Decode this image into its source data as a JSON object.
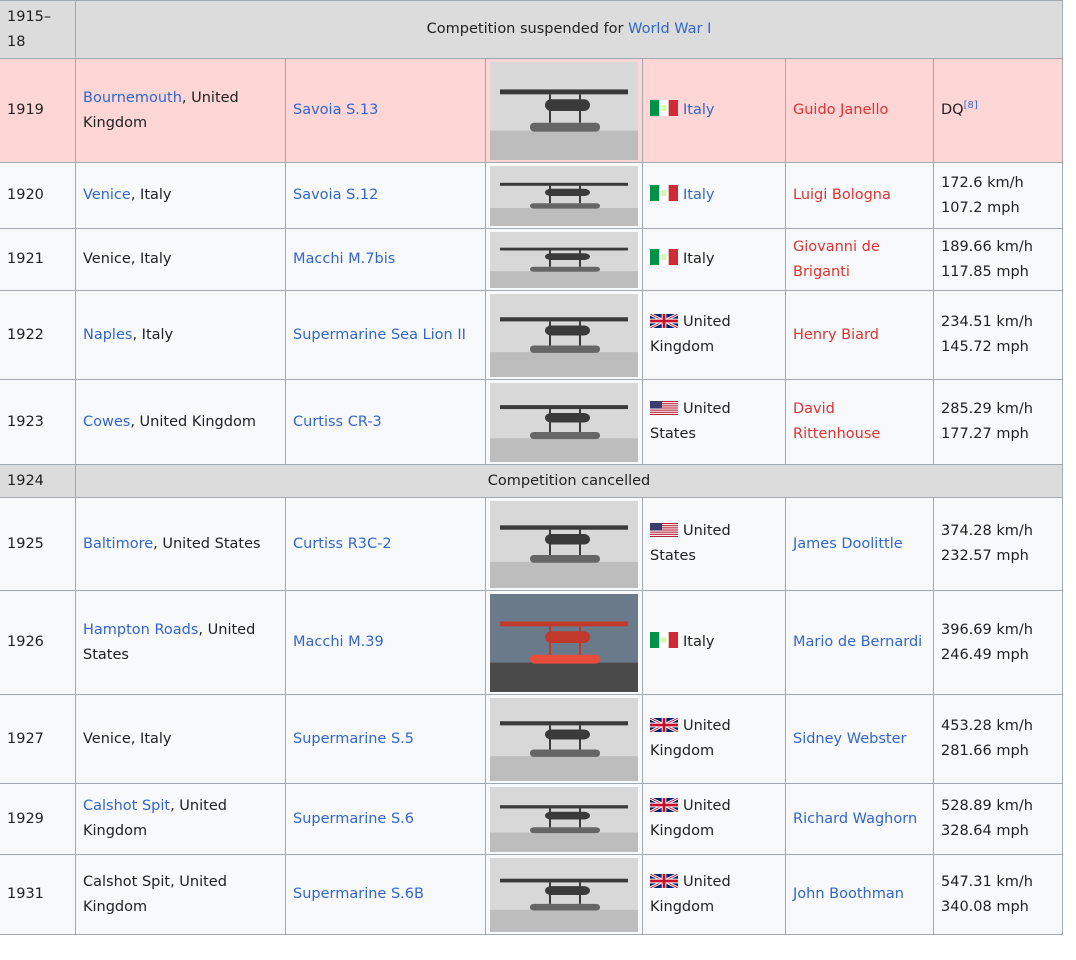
{
  "table": {
    "suspended": {
      "year": "1915–18",
      "text_before": "Competition suspended for ",
      "link": "World War I"
    },
    "cancelled": {
      "year": "1924",
      "text": "Competition cancelled"
    },
    "rows": [
      {
        "year": "1919",
        "loc_link": "Bournemouth",
        "loc_rest": ", United Kingdom",
        "aircraft": "Savoia S.13",
        "country": "Italy",
        "pilot": "Guido Janello",
        "speed_kmh": "DQ",
        "speed_mph": "",
        "sup": "[8]"
      },
      {
        "year": "1920",
        "loc_link": "Venice",
        "loc_rest": ", Italy",
        "aircraft": "Savoia S.12",
        "country": "Italy",
        "pilot": "Luigi Bologna",
        "speed_kmh": "172.6 km/h",
        "speed_mph": "107.2 mph"
      },
      {
        "year": "1921",
        "loc_link": "",
        "loc_rest": "Venice, Italy",
        "aircraft": "Macchi M.7bis",
        "country": "Italy",
        "pilot": "Giovanni de Briganti",
        "speed_kmh": "189.66 km/h",
        "speed_mph": "117.85 mph"
      },
      {
        "year": "1922",
        "loc_link": "Naples",
        "loc_rest": ", Italy",
        "aircraft": "Supermarine Sea Lion II",
        "country": "United Kingdom",
        "pilot": "Henry Biard",
        "speed_kmh": "234.51 km/h",
        "speed_mph": "145.72 mph"
      },
      {
        "year": "1923",
        "loc_link": "Cowes",
        "loc_rest": ", United Kingdom",
        "aircraft": "Curtiss CR-3",
        "country": "United States",
        "pilot": "David Rittenhouse",
        "speed_kmh": "285.29 km/h",
        "speed_mph": "177.27 mph"
      },
      {
        "year": "1925",
        "loc_link": "Baltimore",
        "loc_rest": ", United States",
        "aircraft": "Curtiss R3C-2",
        "country": "United States",
        "pilot": "James Doolittle",
        "speed_kmh": "374.28 km/h",
        "speed_mph": "232.57 mph"
      },
      {
        "year": "1926",
        "loc_link": "Hampton Roads",
        "loc_rest": ", United States",
        "aircraft": "Macchi M.39",
        "country": "Italy",
        "pilot": "Mario de Bernardi",
        "speed_kmh": "396.69 km/h",
        "speed_mph": "246.49 mph"
      },
      {
        "year": "1927",
        "loc_link": "",
        "loc_rest": "Venice, Italy",
        "aircraft": "Supermarine S.5",
        "country": "United Kingdom",
        "pilot": "Sidney Webster",
        "speed_kmh": "453.28 km/h",
        "speed_mph": "281.66 mph"
      },
      {
        "year": "1929",
        "loc_link": "Calshot Spit",
        "loc_rest": ", United Kingdom",
        "aircraft": "Supermarine S.6",
        "country": "United Kingdom",
        "pilot": "Richard Waghorn",
        "speed_kmh": "528.89 km/h",
        "speed_mph": "328.64 mph"
      },
      {
        "year": "1931",
        "loc_link": "",
        "loc_rest": "Calshot Spit, United Kingdom",
        "aircraft": "Supermarine S.6B",
        "country": "United Kingdom",
        "pilot": "John Boothman",
        "speed_kmh": "547.31 km/h",
        "speed_mph": "340.08 mph"
      }
    ]
  },
  "flag_icons": {
    "Italy": "italy-flag-icon",
    "United Kingdom": "uk-flag-icon",
    "United States": "us-flag-icon"
  },
  "colors": {
    "link": "#3366cc",
    "redlink": "#d33",
    "dq_row": "#ffd6d6",
    "separator_row": "#dcdcdc"
  }
}
